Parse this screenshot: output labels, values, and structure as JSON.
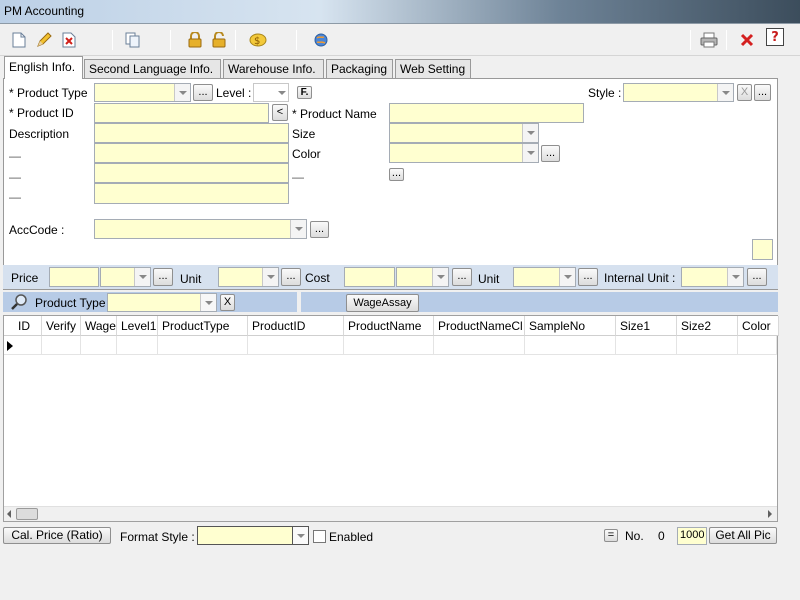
{
  "window": {
    "title": "PM Accounting"
  },
  "tabs": [
    "English Info.",
    "Second Language Info.",
    "Warehouse Info.",
    "Packaging",
    "Web Setting"
  ],
  "form": {
    "product_type_label": "* Product Type",
    "level_label": "Level :",
    "f_button": "F.",
    "style_label": "Style :",
    "x_button": "X",
    "ellipsis": "...",
    "product_id_label": "* Product ID",
    "lt_button": "<",
    "product_name_label": "* Product Name",
    "description_label": "Description",
    "size_label": "Size",
    "color_label": "Color",
    "dash": "—",
    "acccode_label": "AccCode :"
  },
  "price_strip": {
    "price_label": "Price",
    "unit_label": "Unit",
    "cost_label": "Cost",
    "unit2_label": "Unit",
    "internal_unit_label": "Internal Unit :"
  },
  "filter": {
    "product_type_label": "Product Type",
    "x_button": "X",
    "wage_assay_button": "WageAssay"
  },
  "grid": {
    "columns": [
      "ID",
      "Verify",
      "Wage",
      "Level1",
      "ProductType",
      "ProductID",
      "ProductName",
      "ProductNameCl",
      "SampleNo",
      "Size1",
      "Size2",
      "Color"
    ]
  },
  "bottom": {
    "cal_price_button": "Cal. Price (Ratio)",
    "format_style_label": "Format Style :",
    "enabled_label": "Enabled",
    "eq_button": "=",
    "no_label": "No.",
    "no_value": "0",
    "count_value": "1000",
    "get_all_pic_button": "Get All Pic"
  },
  "colors": {
    "field_bg": "#ffffd0",
    "strip_bg": "#d6e1ef",
    "filter_bg": "#b7cbe6"
  }
}
